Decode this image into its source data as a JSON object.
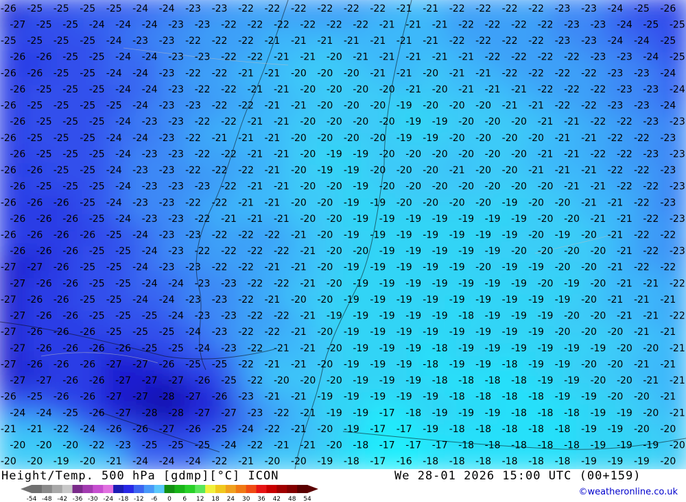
{
  "map": {
    "rows": [
      "26 25 25 25 25 24 24 23 23 22 22 22 22 22 22 21 21 22 22 22 22 23 23 24 25 26",
      "27 25 25 24 24 24 23 23 22 22 22 22 22 22 21 21 21 22 22 22 22 23 23 24 25 25",
      "25 25 25 25 24 23 23 22 22 22 21 21 21 21 21 21 21 22 22 22 22 23 23 24 24 25",
      "26 26 25 25 24 24 23 23 22 22 21 21 20 21 21 21 21 21 22 22 22 22 23 23 24 25",
      "26 26 25 25 24 24 23 22 22 21 21 20 20 20 21 21 20 21 21 22 22 22 22 23 23 24",
      "26 25 25 25 24 24 23 22 22 21 21 20 20 20 20 21 20 21 21 21 22 22 22 23 23 24",
      "26 25 25 25 25 24 23 23 22 22 21 21 20 20 20 19 20 20 20 21 21 22 22 23 23 24",
      "26 25 25 25 24 23 23 22 22 21 21 20 20 20 20 19 19 20 20 20 21 21 22 22 23 23",
      "26 25 25 25 24 24 23 22 21 21 21 20 20 20 20 19 19 20 20 20 20 21 21 22 22 23",
      "26 25 25 25 24 23 23 22 22 21 21 20 19 19 20 20 20 20 20 20 21 21 22 22 23 23",
      "26 26 25 25 24 23 23 22 22 22 21 20 19 19 20 20 20 21 20 20 21 21 21 22 22 23",
      "26 25 25 25 24 23 23 23 22 21 21 20 20 19 20 20 20 20 20 20 20 21 21 22 22 23",
      "26 26 26 25 24 23 23 22 22 21 21 20 20 19 19 20 20 20 20 19 20 20 21 21 22 23",
      "26 26 26 25 24 23 23 22 21 21 21 20 20 19 19 19 19 19 19 19 20 20 21 21 22 23",
      "26 26 26 26 25 24 23 23 22 22 22 21 20 19 19 19 19 19 19 19 20 19 20 21 22 22",
      "26 26 26 25 25 24 23 22 22 22 22 21 20 20 19 19 19 19 19 20 20 20 20 21 22 23",
      "27 27 26 25 25 24 23 23 22 22 21 21 20 19 19 19 19 19 20 19 19 20 20 21 22 22",
      "27 26 26 25 25 24 24 23 23 22 22 21 20 19 19 19 19 19 19 19 20 19 20 21 21 22",
      "27 26 26 25 25 24 24 23 23 22 21 20 20 19 19 19 19 19 19 19 19 19 20 21 21 21",
      "27 26 26 25 25 25 24 23 23 22 22 21 19 19 19 19 19 18 19 19 19 20 20 21 21 22",
      "27 26 26 26 25 25 25 24 23 22 22 21 20 19 19 19 19 19 19 19 19 20 20 20 21 21",
      "27 26 26 26 26 25 25 24 23 22 21 21 20 19 19 19 18 19 19 19 19 19 19 20 20 21",
      "27 26 26 26 27 27 26 25 25 22 21 21 20 19 19 19 18 19 19 18 19 19 20 20 21 21",
      "27 27 26 26 27 27 27 26 25 22 20 20 20 19 19 19 18 18 18 18 19 19 20 20 21 21",
      "26 25 26 26 27 27 28 27 26 23 21 21 19 19 19 19 19 18 18 18 18 19 19 20 20 21",
      "24 24 25 26 27 28 28 27 27 23 22 21 19 19 17 18 19 19 19 18 18 18 19 19 20 21",
      "21 21 22 24 26 26 27 26 25 24 22 21 20 19 17 17 19 18 18 18 18 18 19 19 20 20",
      "20 20 20 22 23 25 25 25 24 22 21 21 20 18 17 17 17 18 18 18 18 18 19 19 19 20",
      "20 20 19 20 21 24 24 24 22 21 20 20 19 18 17 16 18 18 18 18 18 18 19 19 19 20"
    ]
  },
  "footer": {
    "title_left": "Height/Temp. 500 hPa [gdmp][°C] ICON",
    "title_right": "We 28-01 2026 15:00 UTC (00+159)",
    "credit": "©weatheronline.co.uk",
    "scale_labels": [
      "-54",
      "-48",
      "-42",
      "-36",
      "-30",
      "-24",
      "-18",
      "-12",
      "-6",
      "0",
      "6",
      "12",
      "18",
      "24",
      "30",
      "36",
      "42",
      "48",
      "54"
    ],
    "scale_colors": [
      "#707070",
      "#8a8a8a",
      "#a8a8a8",
      "#c8c8c8",
      "#7a2b8a",
      "#a23bb0",
      "#c64fd0",
      "#e070e0",
      "#1c1cb4",
      "#2828e6",
      "#3c64f0",
      "#4898f8",
      "#5ac8fa",
      "#129012",
      "#18b418",
      "#28d028",
      "#5ae65a",
      "#f0f03c",
      "#f0c81e",
      "#f0a01e",
      "#f07814",
      "#f04b14",
      "#e61414",
      "#c80000",
      "#a00000",
      "#820000",
      "#5a0000"
    ]
  }
}
